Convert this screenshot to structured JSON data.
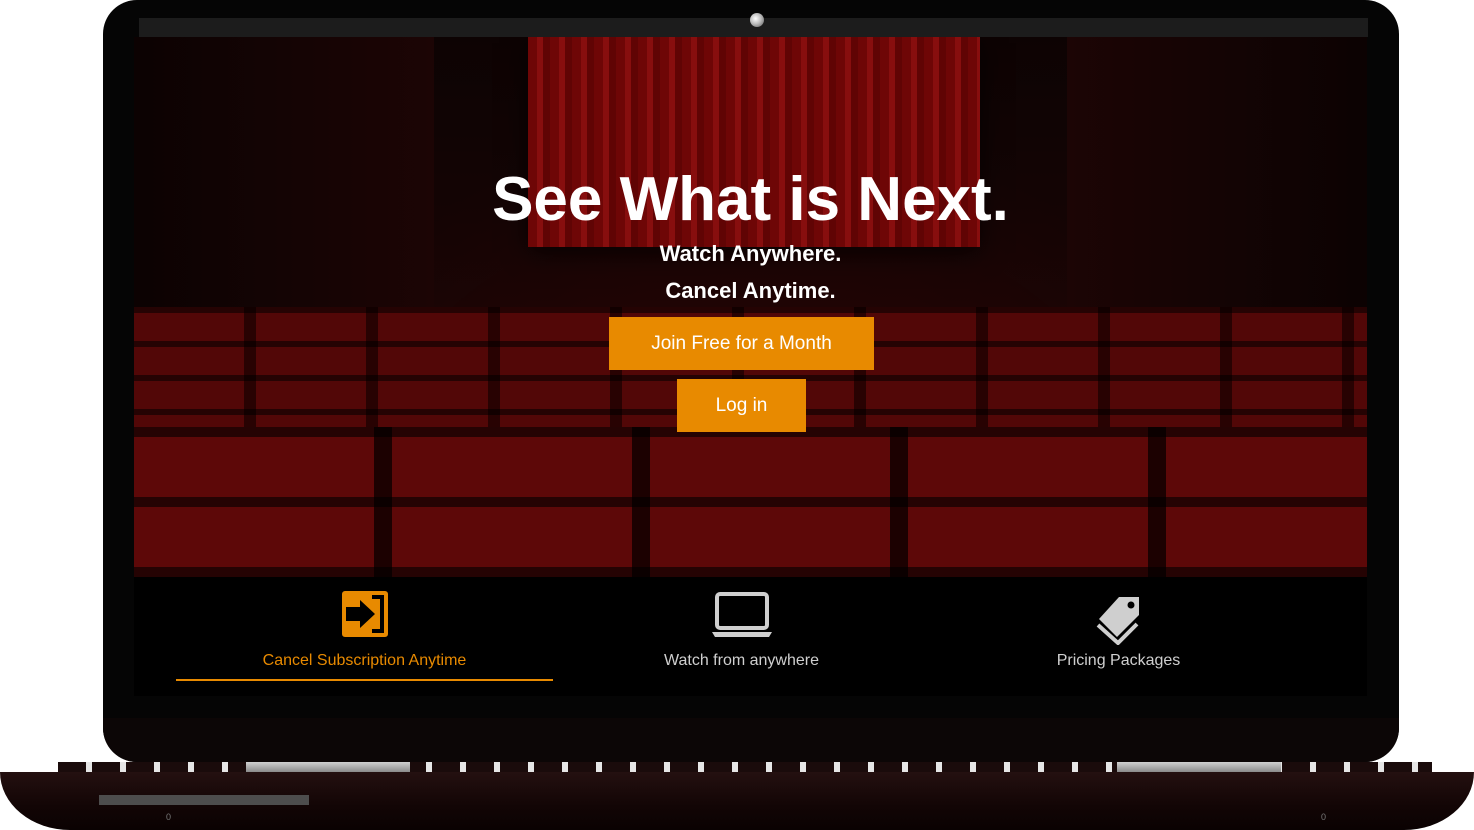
{
  "hero": {
    "headline": "See What is Next.",
    "subline_1": "Watch Anywhere.",
    "subline_2": "Cancel Anytime.",
    "join_button": "Join Free for a Month",
    "login_button": "Log in"
  },
  "tabs": [
    {
      "label": "Cancel Subscription Anytime",
      "icon": "sign-in-icon",
      "active": true
    },
    {
      "label": "Watch from anywhere",
      "icon": "laptop-icon",
      "active": false
    },
    {
      "label": "Pricing Packages",
      "icon": "price-tags-icon",
      "active": false
    }
  ],
  "device": {
    "base_mark_left": "0",
    "base_mark_right": "0"
  },
  "colors": {
    "accent": "#e88a00",
    "tab_text": "#cfcfcf",
    "background": "#000000"
  }
}
